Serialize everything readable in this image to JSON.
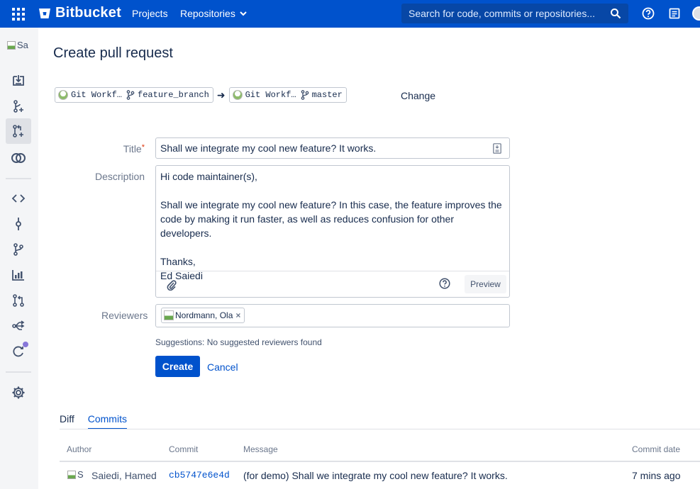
{
  "header": {
    "app_name": "Bitbucket",
    "nav": {
      "projects": "Projects",
      "repositories": "Repositories"
    },
    "search_placeholder": "Search for code, commits or repositories...",
    "brand_color": "#0052cc"
  },
  "sidebar": {
    "repo_avatar_alt": "Sa",
    "items": [
      {
        "icon": "clone-icon"
      },
      {
        "icon": "create-branch-icon"
      },
      {
        "icon": "create-pull-request-icon",
        "active": true
      },
      {
        "icon": "compare-icon"
      },
      {
        "icon": "source-icon"
      },
      {
        "icon": "commits-icon"
      },
      {
        "icon": "branches-icon"
      },
      {
        "icon": "insights-icon"
      },
      {
        "icon": "pull-requests-icon"
      },
      {
        "icon": "forks-icon"
      },
      {
        "icon": "builds-icon"
      },
      {
        "icon": "settings-icon"
      }
    ]
  },
  "page": {
    "title": "Create pull request",
    "source": {
      "repo": "Git Workf…",
      "branch": "feature_branch"
    },
    "target": {
      "repo": "Git Workf…",
      "branch": "master"
    },
    "arrow": "➜",
    "change_label": "Change"
  },
  "form": {
    "title_label": "Title",
    "required_mark": "*",
    "title_value": "Shall we integrate my cool new feature? It works.",
    "description_label": "Description",
    "description_value": "Hi code maintainer(s),\n\nShall we integrate my cool new feature? In this case, the feature improves the code by making it run faster, as well as reduces confusion for other developers.\n\nThanks,\nEd Saiedi",
    "preview_label": "Preview",
    "reviewers_label": "Reviewers",
    "reviewer_chip": "Nordmann, Ola",
    "suggestions_text": "Suggestions: No suggested reviewers found",
    "create_label": "Create",
    "cancel_label": "Cancel"
  },
  "tabs": [
    {
      "label": "Diff",
      "active": false
    },
    {
      "label": "Commits",
      "active": true
    }
  ],
  "commits_table": {
    "columns": [
      "Author",
      "Commit",
      "Message",
      "Commit date"
    ],
    "rows": [
      {
        "avatar_alt": "S",
        "author": "Saiedi, Hamed",
        "hash": "cb5747e6e4d",
        "message": "(for demo) Shall we integrate my cool new feature? It works.",
        "date": "7 mins ago"
      }
    ]
  }
}
